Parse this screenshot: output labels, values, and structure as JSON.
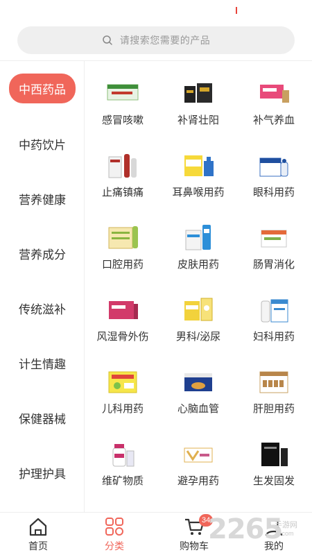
{
  "search": {
    "placeholder": "请搜索您需要的产品"
  },
  "sidebar": {
    "items": [
      {
        "label": "中西药品",
        "active": true
      },
      {
        "label": "中药饮片"
      },
      {
        "label": "营养健康"
      },
      {
        "label": "营养成分"
      },
      {
        "label": "传统滋补"
      },
      {
        "label": "计生情趣"
      },
      {
        "label": "保健器械"
      },
      {
        "label": "护理护具"
      }
    ]
  },
  "grid": {
    "items": [
      {
        "label": "感冒咳嗽",
        "icon": "cold-medicine-box"
      },
      {
        "label": "补肾壮阳",
        "icon": "kidney-tonic-box"
      },
      {
        "label": "补气养血",
        "icon": "qi-blood-box"
      },
      {
        "label": "止痛镇痛",
        "icon": "painkiller-box"
      },
      {
        "label": "耳鼻喉用药",
        "icon": "ent-medicine-box"
      },
      {
        "label": "眼科用药",
        "icon": "eye-drops-box"
      },
      {
        "label": "口腔用药",
        "icon": "oral-medicine-box"
      },
      {
        "label": "皮肤用药",
        "icon": "skin-medicine-tube"
      },
      {
        "label": "肠胃消化",
        "icon": "stomach-medicine-box"
      },
      {
        "label": "风湿骨外伤",
        "icon": "rheumatism-box"
      },
      {
        "label": "男科/泌尿",
        "icon": "mens-health-box"
      },
      {
        "label": "妇科用药",
        "icon": "gynecology-box"
      },
      {
        "label": "儿科用药",
        "icon": "pediatric-box"
      },
      {
        "label": "心脑血管",
        "icon": "cardio-box"
      },
      {
        "label": "肝胆用药",
        "icon": "liver-box"
      },
      {
        "label": "维矿物质",
        "icon": "vitamin-bottle"
      },
      {
        "label": "避孕用药",
        "icon": "contraceptive-box"
      },
      {
        "label": "生发固发",
        "icon": "hair-growth-box"
      }
    ]
  },
  "tabbar": {
    "tabs": [
      {
        "label": "首页",
        "icon": "home-icon"
      },
      {
        "label": "分类",
        "icon": "category-icon",
        "active": true
      },
      {
        "label": "购物车",
        "icon": "cart-icon",
        "badge": "34"
      },
      {
        "label": "我的",
        "icon": "profile-icon"
      }
    ]
  },
  "watermark": {
    "number": "2265",
    "text": "手游网",
    "domain": ".com"
  },
  "colors": {
    "accent": "#f0665a",
    "text": "#333333",
    "placeholder": "#9a9a9a"
  }
}
